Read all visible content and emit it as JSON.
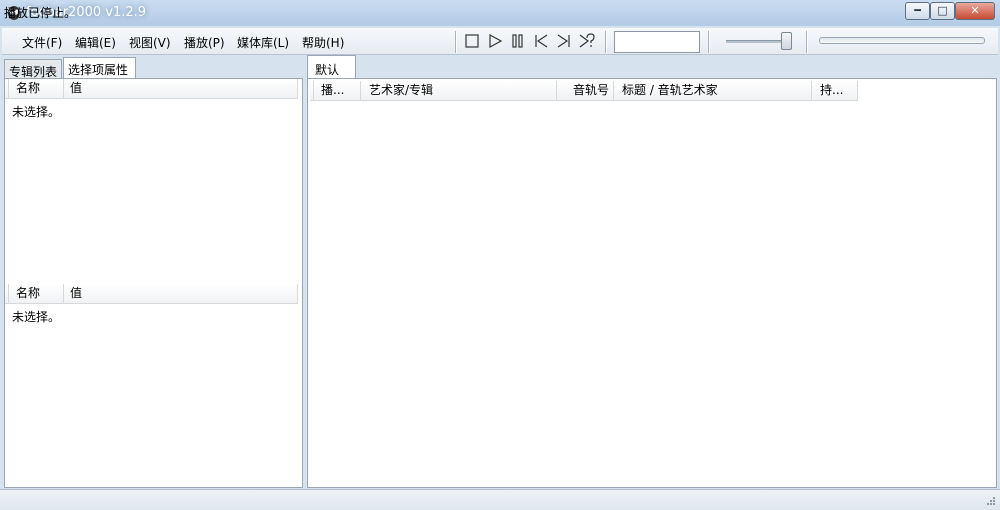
{
  "window": {
    "title": "foobar2000 v1.2.9",
    "minimize": "━",
    "maximize": "□",
    "close": "✕"
  },
  "menu": [
    {
      "label": "文件(F)"
    },
    {
      "label": "编辑(E)"
    },
    {
      "label": "视图(V)"
    },
    {
      "label": "播放(P)"
    },
    {
      "label": "媒体库(L)"
    },
    {
      "label": "帮助(H)"
    }
  ],
  "toolbar": {
    "buttons": [
      "stop-icon",
      "play-icon",
      "pause-icon",
      "previous-icon",
      "next-icon",
      "random-icon"
    ],
    "volume_level": 1.0,
    "seek_position": 0
  },
  "left": {
    "tabs": [
      {
        "label": "专辑列表"
      },
      {
        "label": "选择项属性"
      }
    ],
    "active_tab": 1,
    "top_panel": {
      "columns": [
        "名称",
        "值"
      ],
      "empty_text": "未选择。"
    },
    "bottom_panel": {
      "columns": [
        "名称",
        "值"
      ],
      "empty_text": "未选择。"
    }
  },
  "playlist": {
    "tab": "默认",
    "columns": [
      "播...",
      "艺术家/专辑",
      "音轨号",
      "标题 / 音轨艺术家",
      "持..."
    ]
  },
  "status": {
    "text": "播放已停止。"
  }
}
